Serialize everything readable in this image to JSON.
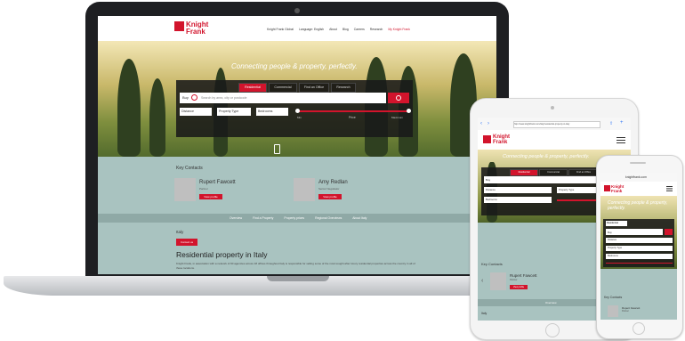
{
  "brand": {
    "name_line1": "Knight",
    "name_line2": "Frank",
    "accent": "#d2142c"
  },
  "laptop": {
    "nav": [
      "Knight Frank Global",
      "Language: English",
      "About",
      "Blog",
      "Careers",
      "Research",
      "My Knight Frank"
    ],
    "tagline": "Connecting people & property, perfectly.",
    "tabs": [
      "Residential",
      "Commercial",
      "Find an Office",
      "Research"
    ],
    "search_prefix": "Buy",
    "search_placeholder": "Search by area, city or postcode",
    "filters": [
      "Distance",
      "Property Type",
      "Bedrooms"
    ],
    "price_label": "Price",
    "price_min": "Min",
    "price_max": "Maximum",
    "key_contacts_title": "Key Contacts",
    "contacts": [
      {
        "name": "Rupert Fawcett",
        "role": "Partner",
        "btn": "View profile"
      },
      {
        "name": "Amy Redlan",
        "role": "Senior Negotiator",
        "btn": "View profile"
      }
    ],
    "subnav": [
      "Overview",
      "Find a Property",
      "Property prices",
      "Regional Overviews",
      "About Italy"
    ],
    "section_label": "Italy",
    "section_btn": "Contact us",
    "heading": "Residential property in Italy",
    "body_text": "Knight Frank, in association with a network of 90 agencies across 18 offices throughout Italy is responsible for selling some of the most sought after luxury residential properties across the country in all of these locations."
  },
  "tablet": {
    "url": "http://www.knightfrank.com/italy/residential-property-in-italy",
    "tagline": "Connecting people & property, perfectly.",
    "tabs": [
      "Residential",
      "Commercial",
      "Find an Office",
      "Research"
    ],
    "search_prefix": "Buy",
    "filters": [
      "Distance",
      "Property Type",
      "Bedrooms"
    ],
    "key_contacts_title": "Key Contacts",
    "contact": {
      "name": "Rupert Fawcett",
      "role": "Partner",
      "btn": "View profile"
    },
    "subnav": "Overview",
    "section": "Italy"
  },
  "phone": {
    "url": "knightfrank.com",
    "tagline": "Connecting people & property, perfectly.",
    "tab": "Residential",
    "search_prefix": "Buy",
    "filters": [
      "Distance",
      "Property Type",
      "Bedrooms"
    ],
    "key_contacts_title": "Key Contacts",
    "contact": {
      "name": "Rupert Fawcett",
      "role": "Partner"
    }
  }
}
